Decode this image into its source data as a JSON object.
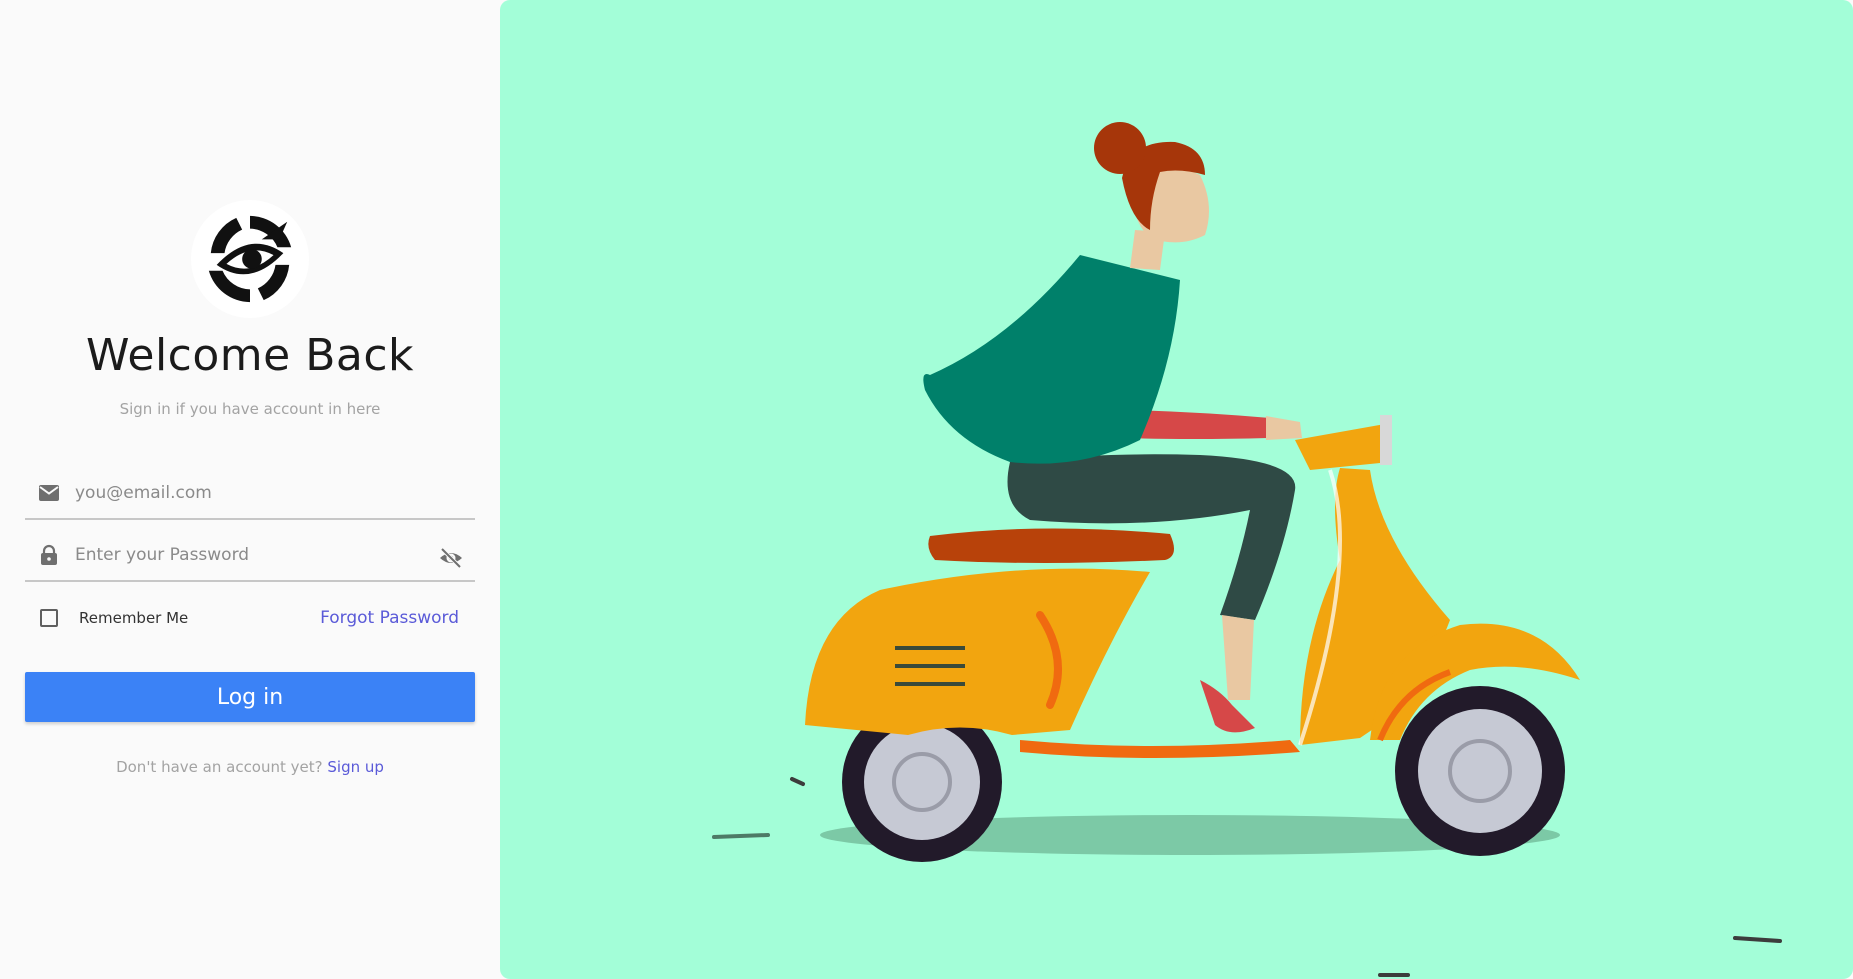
{
  "app": {
    "title": "Welcome Back",
    "subtitle": "Sign in if you have account in here"
  },
  "form": {
    "email": {
      "placeholder": "you@email.com",
      "value": "",
      "icon": "mail-icon"
    },
    "password": {
      "placeholder": "Enter your Password",
      "value": "",
      "icon": "lock-icon",
      "toggle_icon": "eye-off-icon"
    },
    "remember_label": "Remember Me",
    "remember_checked": false,
    "forgot_label": "Forgot Password",
    "login_label": "Log in",
    "signup_prompt": "Don't have an account yet?",
    "signup_label": "Sign up"
  },
  "illustration": {
    "name": "scooter-rider-illustration",
    "background": "#a3fed8"
  },
  "colors": {
    "accent": "#3b82f6",
    "link": "#5a5ad8",
    "panel_bg": "#fafafa"
  }
}
